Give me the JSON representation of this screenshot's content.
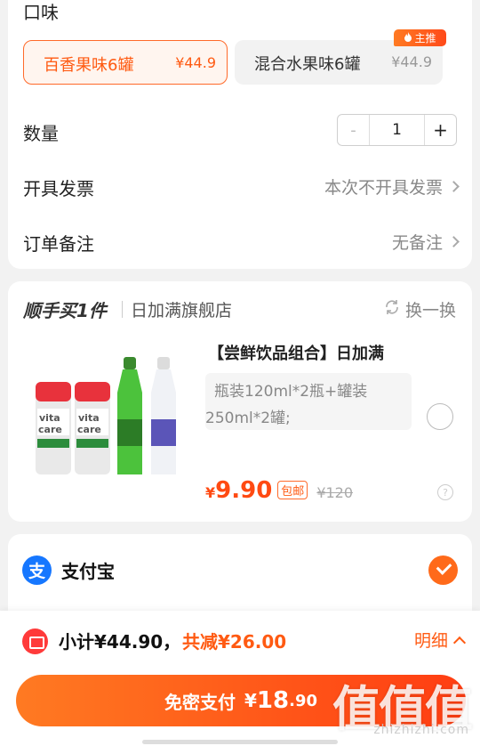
{
  "options": {
    "flavor_label": "口味",
    "flavors": [
      {
        "name": "百香果味6罐",
        "price": "¥44.9",
        "selected": true
      },
      {
        "name": "混合水果味6罐",
        "price": "¥44.9",
        "selected": false,
        "badge": "主推"
      }
    ],
    "quantity_label": "数量",
    "quantity": {
      "minus": "-",
      "value": "1",
      "plus": "+"
    },
    "invoice_label": "开具发票",
    "invoice_value": "本次不开具发票",
    "note_label": "订单备注",
    "note_value": "无备注"
  },
  "addon": {
    "title": "顺手买1件",
    "store": "日加满旗舰店",
    "swap_label": "换一换",
    "product_title": "【尝鲜饮品组合】日加满",
    "spec_line1": "瓶装120ml*2瓶+罐装",
    "spec_line2": "250ml*2罐;",
    "price_symbol": "¥",
    "price": "9.90",
    "shipping_tag": "包邮",
    "original_price": "¥120",
    "help": "?"
  },
  "payment": {
    "method": "支付宝",
    "logo_glyph": "支"
  },
  "footer": {
    "subtotal": "小计¥44.90，",
    "discount": "共减¥26.00",
    "detail": "明细",
    "pay_label": "免密支付",
    "pay_symbol": "¥",
    "pay_int": "18",
    "pay_dec": ".90"
  },
  "watermark": {
    "text": "值值值",
    "url": "zhizhizhi.com"
  },
  "colors": {
    "accent": "#ff5a12",
    "alipay": "#1677ff"
  }
}
